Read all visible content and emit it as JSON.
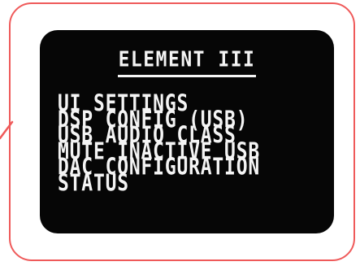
{
  "device": {
    "title": "ELEMENT III"
  },
  "menu": {
    "items": [
      {
        "label": "UI SETTINGS"
      },
      {
        "label": "DSP CONFIG (USB)"
      },
      {
        "label": "USB AUDIO CLASS"
      },
      {
        "label": "MUTE INACTIVE USB"
      },
      {
        "label": "DAC CONFIGURATION"
      },
      {
        "label": "STATUS"
      }
    ]
  },
  "colors": {
    "callout_border": "#ef5a5a",
    "screen_background": "#060606",
    "screen_text": "#f4f4f4"
  }
}
